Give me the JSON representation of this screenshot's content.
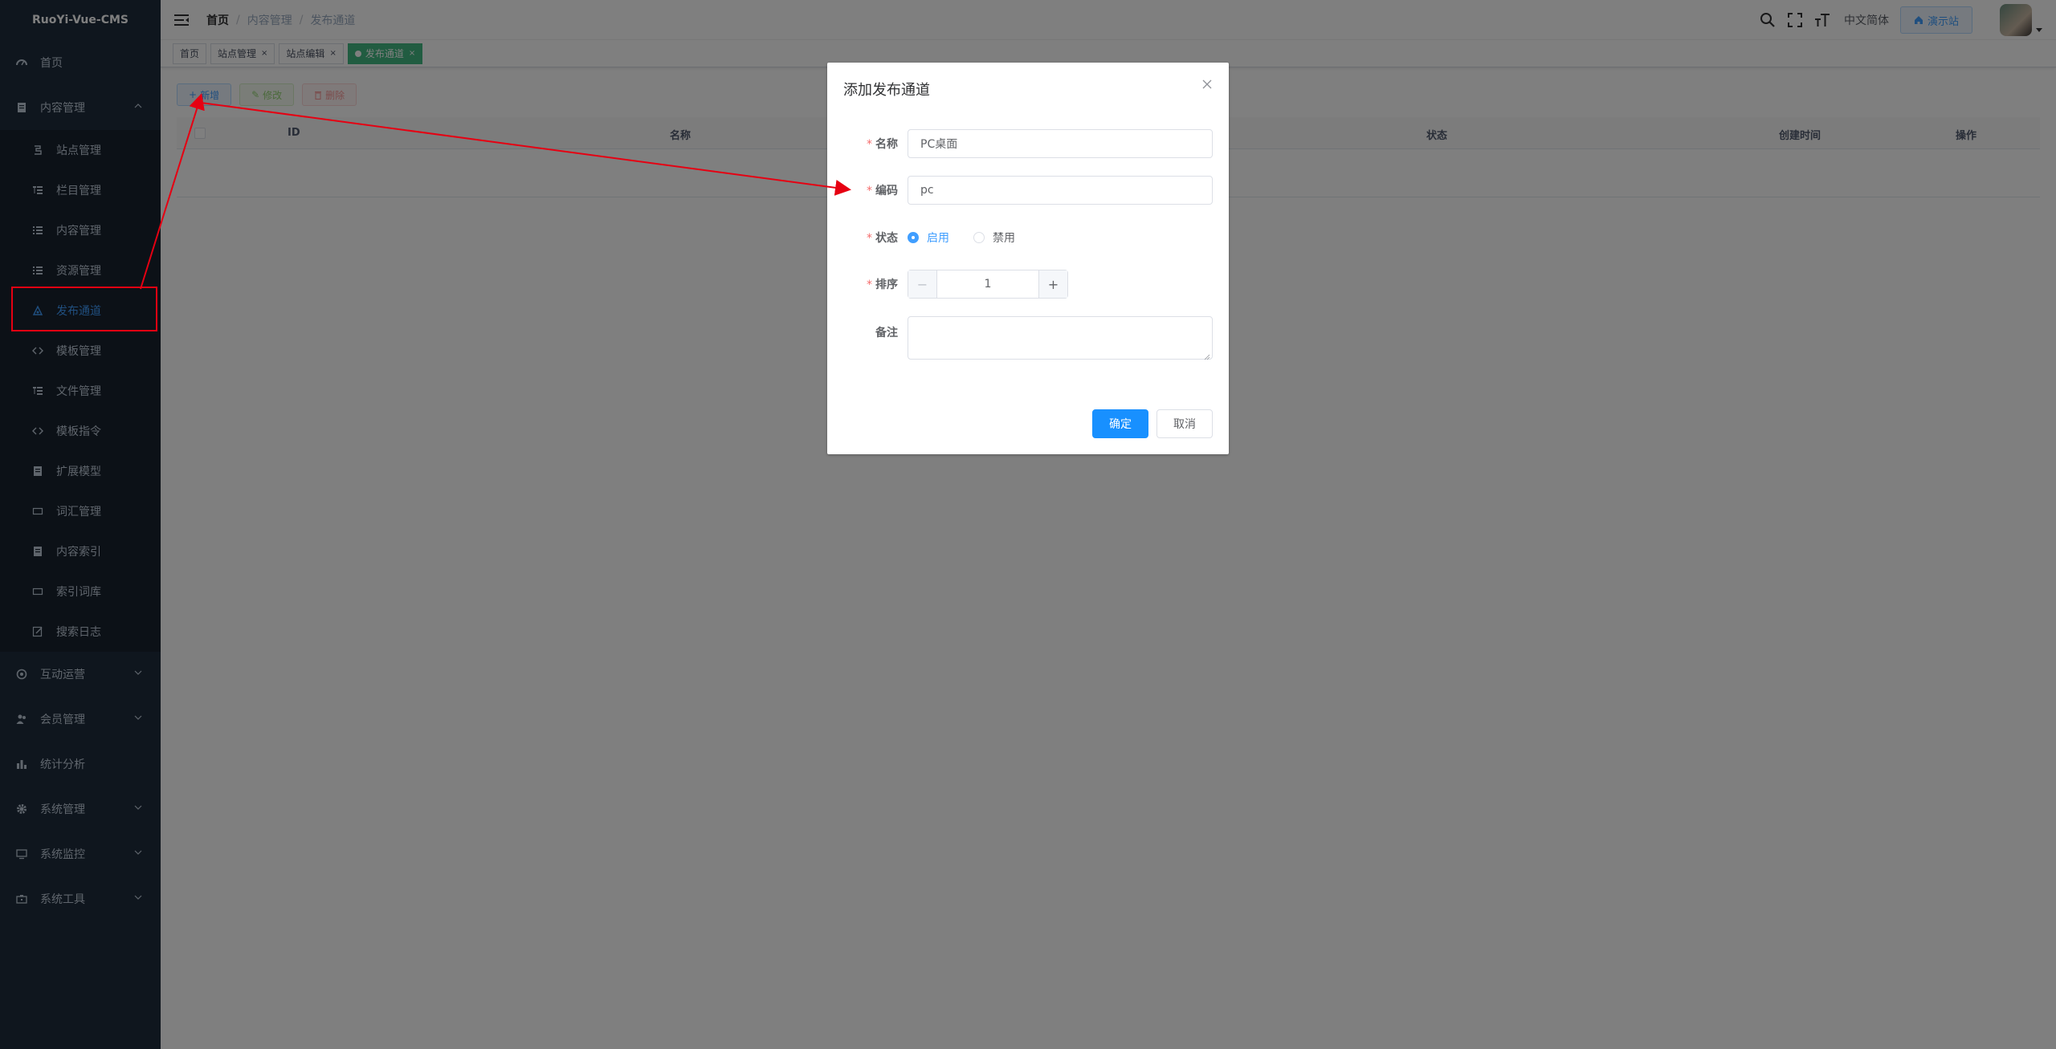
{
  "app": {
    "title": "RuoYi-Vue-CMS"
  },
  "sidebar": {
    "top_items": [
      {
        "label": "首页",
        "icon": "dashboard-icon"
      },
      {
        "label": "内容管理",
        "icon": "document-icon",
        "expanded": true
      }
    ],
    "sub_items": [
      {
        "label": "站点管理",
        "icon": "site-icon"
      },
      {
        "label": "栏目管理",
        "icon": "tree-icon"
      },
      {
        "label": "内容管理",
        "icon": "list-icon"
      },
      {
        "label": "资源管理",
        "icon": "list-icon"
      },
      {
        "label": "发布通道",
        "icon": "publish-icon",
        "active": true
      },
      {
        "label": "模板管理",
        "icon": "code-icon"
      },
      {
        "label": "文件管理",
        "icon": "tree-icon"
      },
      {
        "label": "模板指令",
        "icon": "code-icon"
      },
      {
        "label": "扩展模型",
        "icon": "document-icon"
      },
      {
        "label": "词汇管理",
        "icon": "box-icon"
      },
      {
        "label": "内容索引",
        "icon": "document-icon"
      },
      {
        "label": "索引词库",
        "icon": "box-icon"
      },
      {
        "label": "搜索日志",
        "icon": "edit-icon"
      }
    ],
    "bottom_items": [
      {
        "label": "互动运营",
        "icon": "interact-icon",
        "has_children": true
      },
      {
        "label": "会员管理",
        "icon": "members-icon",
        "has_children": true
      },
      {
        "label": "统计分析",
        "icon": "chart-icon",
        "has_children": false
      },
      {
        "label": "系统管理",
        "icon": "gear-icon",
        "has_children": true
      },
      {
        "label": "系统监控",
        "icon": "monitor-icon",
        "has_children": true
      },
      {
        "label": "系统工具",
        "icon": "tools-icon",
        "has_children": true
      }
    ]
  },
  "navbar": {
    "breadcrumb": [
      "首页",
      "内容管理",
      "发布通道"
    ],
    "lang": "中文简体",
    "demo_button": "演示站"
  },
  "tags": [
    {
      "label": "首页",
      "closable": false,
      "active": false
    },
    {
      "label": "站点管理",
      "closable": true,
      "active": false
    },
    {
      "label": "站点编辑",
      "closable": true,
      "active": false
    },
    {
      "label": "发布通道",
      "closable": true,
      "active": true
    }
  ],
  "toolbar": {
    "add": "新增",
    "edit": "修改",
    "delete": "删除"
  },
  "table": {
    "columns": [
      "ID",
      "名称",
      "状态",
      "创建时间",
      "操作"
    ]
  },
  "dialog": {
    "title": "添加发布通道",
    "fields": {
      "name_label": "名称",
      "name_value": "PC桌面",
      "code_label": "编码",
      "code_value": "pc",
      "status_label": "状态",
      "status_options": [
        "启用",
        "禁用"
      ],
      "status_selected": "启用",
      "sort_label": "排序",
      "sort_value": "1",
      "remark_label": "备注"
    },
    "ok": "确定",
    "cancel": "取消"
  },
  "colors": {
    "sidebar_bg": "#1f2d3d",
    "accent": "#409eff",
    "primary_btn": "#1890ff",
    "tag_active": "#42b983",
    "annotation_red": "#e60012"
  }
}
